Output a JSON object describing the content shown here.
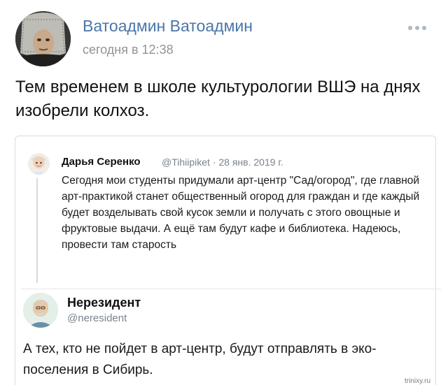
{
  "post": {
    "author": "Ватоадмин Ватоадмин",
    "time": "сегодня в 12:38",
    "more_icon": "more-horizontal-icon",
    "text": "Тем временем в школе культурологии ВШЭ на днях изобрели колхоз."
  },
  "embedded": {
    "tweet1": {
      "name": "Дарья Серенко",
      "meta": "@Tihiipiket · 28 янв. 2019 г.",
      "text": "Сегодня мои студенты придумали арт-центр \"Сад/огород\", где главной арт-практикой станет общественный огород для граждан и где каждый будет возделывать свой кусок земли и получать с этого овощные и фруктовые выдачи. А ещё там будут кафе и библиотека. Надеюсь, провести там старость"
    },
    "tweet2": {
      "name": "Нерезидент",
      "handle": "@neresident",
      "text": "А тех, кто не пойдет в арт-центр, будут отправлять в эко-поселения в Сибирь."
    }
  },
  "watermark": "trinixy.ru",
  "colors": {
    "author": "#4a76a8",
    "muted": "#939393",
    "border": "#d5dde6"
  }
}
